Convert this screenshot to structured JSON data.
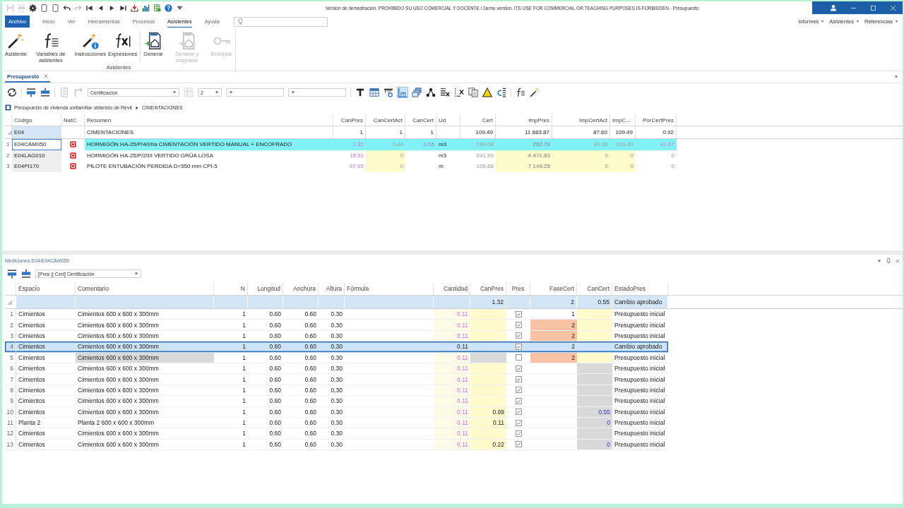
{
  "window": {
    "title": "Versión de demostración. PROHIBIDO SU USO COMERCIAL Y DOCENTE / Demo version. ITS USE FOR COMMERCIAL OR TEACHING PURPOSES IS FORBIDDEN - Presupuesto"
  },
  "quick_access": [
    {
      "kind": "save",
      "disabled": true
    },
    {
      "kind": "print",
      "disabled": true
    },
    {
      "kind": "settings",
      "disabled": false
    },
    {
      "kind": "page",
      "disabled": false
    },
    {
      "kind": "page",
      "disabled": false
    },
    {
      "kind": "undo",
      "disabled": false
    },
    {
      "kind": "redo",
      "disabled": true
    },
    {
      "kind": "first",
      "disabled": false
    },
    {
      "kind": "previous",
      "disabled": false
    },
    {
      "kind": "next",
      "disabled": false
    },
    {
      "kind": "last",
      "disabled": false
    },
    {
      "kind": "import",
      "disabled": false
    },
    {
      "kind": "chart",
      "disabled": false
    },
    {
      "kind": "sheet",
      "disabled": false
    },
    {
      "kind": "help",
      "disabled": false
    },
    {
      "kind": "more",
      "disabled": false
    }
  ],
  "menu": {
    "tabs": [
      {
        "label": "Archivo",
        "kind": "file",
        "selected": false
      },
      {
        "label": "Inicio",
        "kind": "tab",
        "selected": false
      },
      {
        "label": "Ver",
        "kind": "tab",
        "selected": false
      },
      {
        "label": "Herramientas",
        "kind": "tab",
        "selected": false
      },
      {
        "label": "Procesos",
        "kind": "tab",
        "selected": false
      },
      {
        "label": "Asistentes",
        "kind": "tab",
        "selected": true
      },
      {
        "label": "Ayuda",
        "kind": "tab",
        "selected": false
      }
    ],
    "right_menus": [
      "Informes",
      "Asistentes",
      "Referencias"
    ]
  },
  "ribbon": {
    "groups": [
      {
        "label": "Asistentes",
        "sections": [
          {
            "buttons": [
              {
                "kind": "wand",
                "label": "Asistente",
                "disabled": false
              },
              {
                "kind": "variables",
                "label": "Variables de asistentes",
                "disabled": false
              },
              {
                "kind": "instructions",
                "label": "Instrucciones",
                "disabled": false
              },
              {
                "kind": "function",
                "label": "Expresiones",
                "disabled": false
              }
            ]
          },
          {
            "buttons": [
              {
                "kind": "generate",
                "label": "Generar",
                "disabled": false
              },
              {
                "kind": "generate",
                "label": "Generar y traspasar",
                "disabled": true
              },
              {
                "kind": "key",
                "label": "Encriptar",
                "disabled": true
              }
            ]
          }
        ]
      }
    ]
  },
  "doc_tabs": [
    {
      "label": "Presupuesto",
      "selected": true
    }
  ],
  "toolbar": {
    "groups": [
      [
        {
          "kind": "refresh",
          "disabled": false,
          "pressed": false
        }
      ],
      [
        {
          "kind": "insert_above",
          "disabled": false,
          "pressed": false
        },
        {
          "kind": "insert_below",
          "disabled": false,
          "pressed": false
        }
      ],
      [
        {
          "kind": "list",
          "disabled": true,
          "pressed": false
        },
        {
          "kind": "corner",
          "disabled": true,
          "pressed": false
        },
        {
          "kind": "dropdown",
          "value": "Certificación"
        },
        {
          "kind": "grid",
          "disabled": true,
          "pressed": false
        },
        {
          "kind": "dropdown",
          "value": "2"
        },
        {
          "kind": "dropdown"
        },
        {
          "kind": "dropdown"
        }
      ],
      [
        {
          "kind": "text_format",
          "disabled": false,
          "pressed": false
        },
        {
          "kind": "table",
          "disabled": false,
          "pressed": false
        },
        {
          "kind": "ruler",
          "disabled": false,
          "pressed": false
        },
        {
          "kind": "measure",
          "disabled": false,
          "pressed": true
        },
        {
          "kind": "layers",
          "disabled": false,
          "pressed": false
        },
        {
          "kind": "nodes",
          "disabled": false,
          "pressed": false
        },
        {
          "kind": "list_delete",
          "disabled": false,
          "pressed": false
        },
        {
          "kind": "dashed_delete",
          "disabled": false,
          "pressed": false
        },
        {
          "kind": "copy",
          "disabled": false,
          "pressed": false
        },
        {
          "kind": "warning",
          "disabled": false,
          "pressed": false
        },
        {
          "kind": "coin_bars",
          "disabled": false,
          "pressed": false
        }
      ],
      [
        {
          "kind": "variables",
          "disabled": false,
          "pressed": false
        },
        {
          "kind": "wand",
          "disabled": false,
          "pressed": false
        }
      ]
    ]
  },
  "breadcrumb": [
    "Presupuesto de vivienda unifamiliar obtenido de Revit",
    "CIMENTACIONES"
  ],
  "budget_table": {
    "columns": [
      "Código",
      "NatC",
      "Resumen",
      "CanPres",
      "CanCertAct",
      "CanCert",
      "Ud",
      "Cert",
      "ImpPres",
      "ImpCertAct",
      "ImpC...",
      "PorCertPres"
    ],
    "rows": [
      {
        "kind": "parent",
        "selected": false,
        "cells": [
          {
            "kind": "text",
            "text": "E04",
            "color": "#d4e7f8"
          },
          {
            "kind": "empty"
          },
          {
            "kind": "text",
            "text": "CIMENTACIONES"
          },
          {
            "kind": "text",
            "text": "1"
          },
          {
            "kind": "text",
            "text": "1"
          },
          {
            "kind": "text",
            "text": "1"
          },
          {
            "kind": "empty"
          },
          {
            "kind": "text",
            "text": "109.49"
          },
          {
            "kind": "text",
            "text": "11 883.87"
          },
          {
            "kind": "text",
            "text": "87.60"
          },
          {
            "kind": "text",
            "text": "109.49"
          },
          {
            "kind": "text",
            "text": "0.92"
          }
        ]
      },
      {
        "kind": "item",
        "number": "1",
        "selected": true,
        "cells": [
          {
            "kind": "text",
            "text": "E04CAM050"
          },
          {
            "kind": "icon"
          },
          {
            "kind": "text",
            "text": "HORMIGÓN HA-25/P/40/IIa CIMENTACIÓN VERTIDO MANUAL + ENCOFRADO",
            "color": "#80f2f6"
          },
          {
            "kind": "text",
            "text": "1.32",
            "color": "#80f2f6"
          },
          {
            "kind": "text",
            "text": "0.44",
            "color": "#80f2f6"
          },
          {
            "kind": "text",
            "text": "0.55",
            "color": "#80f2f6"
          },
          {
            "kind": "text",
            "text": "m3",
            "color": "#80f2f6"
          },
          {
            "kind": "text",
            "text": "199.08",
            "color": "#80f2f6"
          },
          {
            "kind": "text",
            "text": "262.79",
            "color": "#80f2f6"
          },
          {
            "kind": "text",
            "text": "87.60",
            "color": "#80f2f6"
          },
          {
            "kind": "text",
            "text": "109.49",
            "color": "#80f2f6"
          },
          {
            "kind": "text",
            "text": "41.67",
            "color": "#80f2f6"
          }
        ]
      },
      {
        "kind": "item",
        "number": "2",
        "selected": false,
        "cells": [
          {
            "kind": "text",
            "text": "E04LAG010",
            "color": "#efefef"
          },
          {
            "kind": "icon"
          },
          {
            "kind": "text",
            "text": "HORMIGÓN HA-25/P/20/I VERTIDO GRÚA LOSA"
          },
          {
            "kind": "text",
            "text": "18.51"
          },
          {
            "kind": "text",
            "text": "0",
            "color": "#fdfbcb"
          },
          {
            "kind": "empty"
          },
          {
            "kind": "text",
            "text": "m3"
          },
          {
            "kind": "text",
            "text": "241.59"
          },
          {
            "kind": "text",
            "text": "4 471.83",
            "color": "#fdfbcb"
          },
          {
            "kind": "text",
            "text": "0",
            "color": "#fdfbcb"
          },
          {
            "kind": "text",
            "text": "0",
            "color": "#fdfbcb"
          },
          {
            "kind": "text",
            "text": "0"
          }
        ]
      },
      {
        "kind": "item",
        "number": "3",
        "selected": false,
        "cells": [
          {
            "kind": "text",
            "text": "E04PI170",
            "color": "#efefef"
          },
          {
            "kind": "icon"
          },
          {
            "kind": "text",
            "text": "PILOTE ENTUBACIÓN PERDIDA D=550 mm CPI-5"
          },
          {
            "kind": "text",
            "text": "67.65"
          },
          {
            "kind": "text",
            "text": "0",
            "color": "#fdfbcb"
          },
          {
            "kind": "empty"
          },
          {
            "kind": "text",
            "text": "m"
          },
          {
            "kind": "text",
            "text": "105.68"
          },
          {
            "kind": "text",
            "text": "7 149.25",
            "color": "#fdfbcb"
          },
          {
            "kind": "text",
            "text": "0",
            "color": "#fdfbcb"
          },
          {
            "kind": "text",
            "text": "0",
            "color": "#fdfbcb"
          },
          {
            "kind": "text",
            "text": "0"
          }
        ]
      }
    ]
  },
  "measurements": {
    "title": "Mediciones E04/E04CAM050",
    "toolbar": {
      "items": [
        {
          "kind": "insert_above",
          "disabled": false,
          "pressed": false
        },
        {
          "kind": "insert_below",
          "disabled": false,
          "pressed": false
        },
        {
          "kind": "dropdown",
          "value": "[Pres || Cert] Certificación"
        }
      ]
    },
    "table": {
      "columns": [
        "Espacio",
        "Comentario",
        "N",
        "Longitud",
        "Anchura",
        "Altura",
        "Fórmula",
        "Cantidad",
        "CanPres",
        "Pres",
        "FaseCert",
        "CanCert",
        "EstadoPres"
      ],
      "summary": {
        "cells": [
          {
            "kind": "empty"
          },
          {
            "kind": "empty"
          },
          {
            "kind": "empty"
          },
          {
            "kind": "empty"
          },
          {
            "kind": "empty"
          },
          {
            "kind": "empty"
          },
          {
            "kind": "empty"
          },
          {
            "kind": "empty"
          },
          {
            "kind": "text",
            "text": "1.32"
          },
          {
            "kind": "empty"
          },
          {
            "kind": "text",
            "text": "2"
          },
          {
            "kind": "text",
            "text": "0.55"
          },
          {
            "kind": "text",
            "text": "Cambio aprobado"
          }
        ]
      },
      "rows": [
        {
          "number": "1",
          "selected": false,
          "cells": [
            {
              "kind": "text",
              "text": "Cimientos"
            },
            {
              "kind": "text",
              "text": "Cimientos 600 x 600 x 300mm"
            },
            {
              "kind": "text",
              "text": "1"
            },
            {
              "kind": "text",
              "text": "0.60"
            },
            {
              "kind": "text",
              "text": "0.60"
            },
            {
              "kind": "text",
              "text": "0.30"
            },
            {
              "kind": "empty"
            },
            {
              "kind": "text",
              "text": "0.11",
              "color": "#fdfbe8"
            },
            {
              "kind": "empty",
              "color": "#fffbcc"
            },
            {
              "kind": "check",
              "checked": true
            },
            {
              "kind": "text",
              "text": "1"
            },
            {
              "kind": "empty",
              "color": "#fffbcc"
            },
            {
              "kind": "text",
              "text": "Presupuesto inicial"
            }
          ]
        },
        {
          "number": "2",
          "selected": false,
          "cells": [
            {
              "kind": "text",
              "text": "Cimientos"
            },
            {
              "kind": "text",
              "text": "Cimientos 600 x 600 x 300mm"
            },
            {
              "kind": "text",
              "text": "1"
            },
            {
              "kind": "text",
              "text": "0.60"
            },
            {
              "kind": "text",
              "text": "0.60"
            },
            {
              "kind": "text",
              "text": "0.30"
            },
            {
              "kind": "empty"
            },
            {
              "kind": "text",
              "text": "0.11",
              "color": "#fdfbe8"
            },
            {
              "kind": "empty",
              "color": "#fffbcc"
            },
            {
              "kind": "check",
              "checked": true
            },
            {
              "kind": "text",
              "text": "2",
              "color": "#f9c2a4"
            },
            {
              "kind": "empty",
              "color": "#fffbcc"
            },
            {
              "kind": "text",
              "text": "Presupuesto inicial"
            }
          ]
        },
        {
          "number": "3",
          "selected": false,
          "cells": [
            {
              "kind": "text",
              "text": "Cimientos"
            },
            {
              "kind": "text",
              "text": "Cimientos 600 x 600 x 300mm"
            },
            {
              "kind": "text",
              "text": "1"
            },
            {
              "kind": "text",
              "text": "0.60"
            },
            {
              "kind": "text",
              "text": "0.60"
            },
            {
              "kind": "text",
              "text": "0.30"
            },
            {
              "kind": "empty"
            },
            {
              "kind": "text",
              "text": "0.11",
              "color": "#fdfbe8"
            },
            {
              "kind": "empty",
              "color": "#fffbcc"
            },
            {
              "kind": "check",
              "checked": true
            },
            {
              "kind": "text",
              "text": "2",
              "color": "#f9c2a4"
            },
            {
              "kind": "empty",
              "color": "#fffbcc"
            },
            {
              "kind": "text",
              "text": "Presupuesto inicial"
            }
          ]
        },
        {
          "number": "4",
          "selected": true,
          "cells": [
            {
              "kind": "text",
              "text": "Cimientos"
            },
            {
              "kind": "text",
              "text": "Cimientos 600 x 600 x 300mm"
            },
            {
              "kind": "text",
              "text": "1"
            },
            {
              "kind": "text",
              "text": "0.60"
            },
            {
              "kind": "text",
              "text": "0.60"
            },
            {
              "kind": "text",
              "text": "0.30"
            },
            {
              "kind": "empty"
            },
            {
              "kind": "text",
              "text": "0.11"
            },
            {
              "kind": "empty"
            },
            {
              "kind": "check",
              "checked": true
            },
            {
              "kind": "text",
              "text": "2"
            },
            {
              "kind": "empty"
            },
            {
              "kind": "text",
              "text": "Cambio aprobado"
            }
          ]
        },
        {
          "number": "5",
          "selected": false,
          "cells": [
            {
              "kind": "text",
              "text": "Cimientos"
            },
            {
              "kind": "text",
              "text": "Cimientos 600 x 600 x 300mm",
              "color": "#d9d9d9"
            },
            {
              "kind": "text",
              "text": "1"
            },
            {
              "kind": "text",
              "text": "0.60"
            },
            {
              "kind": "text",
              "text": "0.60"
            },
            {
              "kind": "text",
              "text": "0.30"
            },
            {
              "kind": "empty"
            },
            {
              "kind": "text",
              "text": "0.11",
              "color": "#fdfbe8"
            },
            {
              "kind": "empty",
              "color": "#d9d9d9"
            },
            {
              "kind": "check",
              "checked": false
            },
            {
              "kind": "text",
              "text": "2",
              "color": "#f9c2a4"
            },
            {
              "kind": "empty",
              "color": "#fffbcc"
            },
            {
              "kind": "text",
              "text": "Presupuesto inicial"
            }
          ]
        },
        {
          "number": "6",
          "selected": false,
          "cells": [
            {
              "kind": "text",
              "text": "Cimientos"
            },
            {
              "kind": "text",
              "text": "Cimientos 600 x 600 x 300mm"
            },
            {
              "kind": "text",
              "text": "1"
            },
            {
              "kind": "text",
              "text": "0.60"
            },
            {
              "kind": "text",
              "text": "0.60"
            },
            {
              "kind": "text",
              "text": "0.30"
            },
            {
              "kind": "empty"
            },
            {
              "kind": "text",
              "text": "0.11",
              "color": "#fdfbe8"
            },
            {
              "kind": "empty",
              "color": "#fffbcc"
            },
            {
              "kind": "check",
              "checked": true
            },
            {
              "kind": "empty"
            },
            {
              "kind": "empty",
              "color": "#d9d9d9"
            },
            {
              "kind": "text",
              "text": "Presupuesto inicial"
            }
          ]
        },
        {
          "number": "7",
          "selected": false,
          "cells": [
            {
              "kind": "text",
              "text": "Cimientos"
            },
            {
              "kind": "text",
              "text": "Cimientos 600 x 600 x 300mm"
            },
            {
              "kind": "text",
              "text": "1"
            },
            {
              "kind": "text",
              "text": "0.60"
            },
            {
              "kind": "text",
              "text": "0.60"
            },
            {
              "kind": "text",
              "text": "0.30"
            },
            {
              "kind": "empty"
            },
            {
              "kind": "text",
              "text": "0.11",
              "color": "#fdfbe8"
            },
            {
              "kind": "empty",
              "color": "#fffbcc"
            },
            {
              "kind": "check",
              "checked": true
            },
            {
              "kind": "empty"
            },
            {
              "kind": "empty",
              "color": "#d9d9d9"
            },
            {
              "kind": "text",
              "text": "Presupuesto inicial"
            }
          ]
        },
        {
          "number": "8",
          "selected": false,
          "cells": [
            {
              "kind": "text",
              "text": "Cimientos"
            },
            {
              "kind": "text",
              "text": "Cimientos 600 x 600 x 300mm"
            },
            {
              "kind": "text",
              "text": "1"
            },
            {
              "kind": "text",
              "text": "0.60"
            },
            {
              "kind": "text",
              "text": "0.60"
            },
            {
              "kind": "text",
              "text": "0.30"
            },
            {
              "kind": "empty"
            },
            {
              "kind": "text",
              "text": "0.11",
              "color": "#fdfbe8"
            },
            {
              "kind": "empty",
              "color": "#fffbcc"
            },
            {
              "kind": "check",
              "checked": true
            },
            {
              "kind": "empty"
            },
            {
              "kind": "empty",
              "color": "#d9d9d9"
            },
            {
              "kind": "text",
              "text": "Presupuesto inicial"
            }
          ]
        },
        {
          "number": "9",
          "selected": false,
          "cells": [
            {
              "kind": "text",
              "text": "Cimientos"
            },
            {
              "kind": "text",
              "text": "Cimientos 600 x 600 x 300mm"
            },
            {
              "kind": "text",
              "text": "1"
            },
            {
              "kind": "text",
              "text": "0.60"
            },
            {
              "kind": "text",
              "text": "0.60"
            },
            {
              "kind": "text",
              "text": "0.30"
            },
            {
              "kind": "empty"
            },
            {
              "kind": "text",
              "text": "0.11",
              "color": "#fdfbe8"
            },
            {
              "kind": "empty",
              "color": "#fffbcc"
            },
            {
              "kind": "check",
              "checked": true
            },
            {
              "kind": "empty"
            },
            {
              "kind": "empty",
              "color": "#d9d9d9"
            },
            {
              "kind": "text",
              "text": "Presupuesto inicial"
            }
          ]
        },
        {
          "number": "10",
          "selected": false,
          "cells": [
            {
              "kind": "text",
              "text": "Cimientos"
            },
            {
              "kind": "text",
              "text": "Cimientos 600 x 600 x 300mm"
            },
            {
              "kind": "text",
              "text": "1"
            },
            {
              "kind": "text",
              "text": "0.60"
            },
            {
              "kind": "text",
              "text": "0.60"
            },
            {
              "kind": "text",
              "text": "0.30"
            },
            {
              "kind": "empty"
            },
            {
              "kind": "text",
              "text": "0.11",
              "color": "#fdfbe8"
            },
            {
              "kind": "text",
              "text": "0.99",
              "color": "#fffbcc"
            },
            {
              "kind": "check",
              "checked": true
            },
            {
              "kind": "empty"
            },
            {
              "kind": "text",
              "text": "0.55",
              "color": "#d9d9d9"
            },
            {
              "kind": "text",
              "text": "Presupuesto inicial"
            }
          ]
        },
        {
          "number": "11",
          "selected": false,
          "cells": [
            {
              "kind": "text",
              "text": "Planta 2"
            },
            {
              "kind": "text",
              "text": "Planta 2 600 x 600 x 300mm"
            },
            {
              "kind": "text",
              "text": "1"
            },
            {
              "kind": "text",
              "text": "0.60"
            },
            {
              "kind": "text",
              "text": "0.60"
            },
            {
              "kind": "text",
              "text": "0.30"
            },
            {
              "kind": "empty"
            },
            {
              "kind": "text",
              "text": "0.11",
              "color": "#fdfbe8"
            },
            {
              "kind": "text",
              "text": "0.11",
              "color": "#fffbcc"
            },
            {
              "kind": "check",
              "checked": true
            },
            {
              "kind": "empty"
            },
            {
              "kind": "text",
              "text": "0",
              "color": "#d9d9d9"
            },
            {
              "kind": "text",
              "text": "Presupuesto inicial"
            }
          ]
        },
        {
          "number": "12",
          "selected": false,
          "cells": [
            {
              "kind": "text",
              "text": "Cimientos"
            },
            {
              "kind": "text",
              "text": "Cimientos 600 x 600 x 300mm"
            },
            {
              "kind": "text",
              "text": "1"
            },
            {
              "kind": "text",
              "text": "0.60"
            },
            {
              "kind": "text",
              "text": "0.60"
            },
            {
              "kind": "text",
              "text": "0.30"
            },
            {
              "kind": "empty"
            },
            {
              "kind": "text",
              "text": "0.11",
              "color": "#fdfbe8"
            },
            {
              "kind": "empty",
              "color": "#fffbcc"
            },
            {
              "kind": "check",
              "checked": true
            },
            {
              "kind": "empty"
            },
            {
              "kind": "empty",
              "color": "#d9d9d9"
            },
            {
              "kind": "text",
              "text": "Presupuesto inicial"
            }
          ]
        },
        {
          "number": "13",
          "selected": false,
          "cells": [
            {
              "kind": "text",
              "text": "Cimientos"
            },
            {
              "kind": "text",
              "text": "Cimientos 600 x 600 x 300mm"
            },
            {
              "kind": "text",
              "text": "1"
            },
            {
              "kind": "text",
              "text": "0.60"
            },
            {
              "kind": "text",
              "text": "0.60"
            },
            {
              "kind": "text",
              "text": "0.30"
            },
            {
              "kind": "empty"
            },
            {
              "kind": "text",
              "text": "0.11",
              "color": "#fdfbe8"
            },
            {
              "kind": "text",
              "text": "0.22",
              "color": "#fffbcc"
            },
            {
              "kind": "check",
              "checked": true
            },
            {
              "kind": "empty"
            },
            {
              "kind": "text",
              "text": "0",
              "color": "#d9d9d9"
            },
            {
              "kind": "text",
              "text": "Presupuesto inicial"
            }
          ]
        }
      ]
    }
  }
}
